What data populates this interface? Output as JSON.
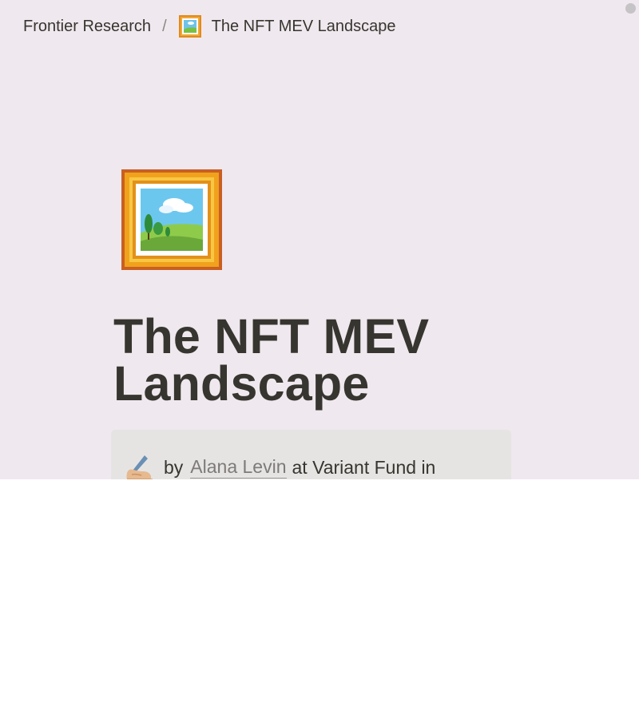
{
  "breadcrumb": {
    "parent": "Frontier Research",
    "separator": "/",
    "current_icon": "framed-picture-icon",
    "current": "The NFT MEV Landscape"
  },
  "page": {
    "icon": "framed-picture-icon",
    "title": "The NFT MEV Landscape"
  },
  "callout": {
    "icon": "writing-hand-icon",
    "prefix": "by",
    "author": "Alana Levin",
    "suffix": "at Variant Fund in"
  }
}
